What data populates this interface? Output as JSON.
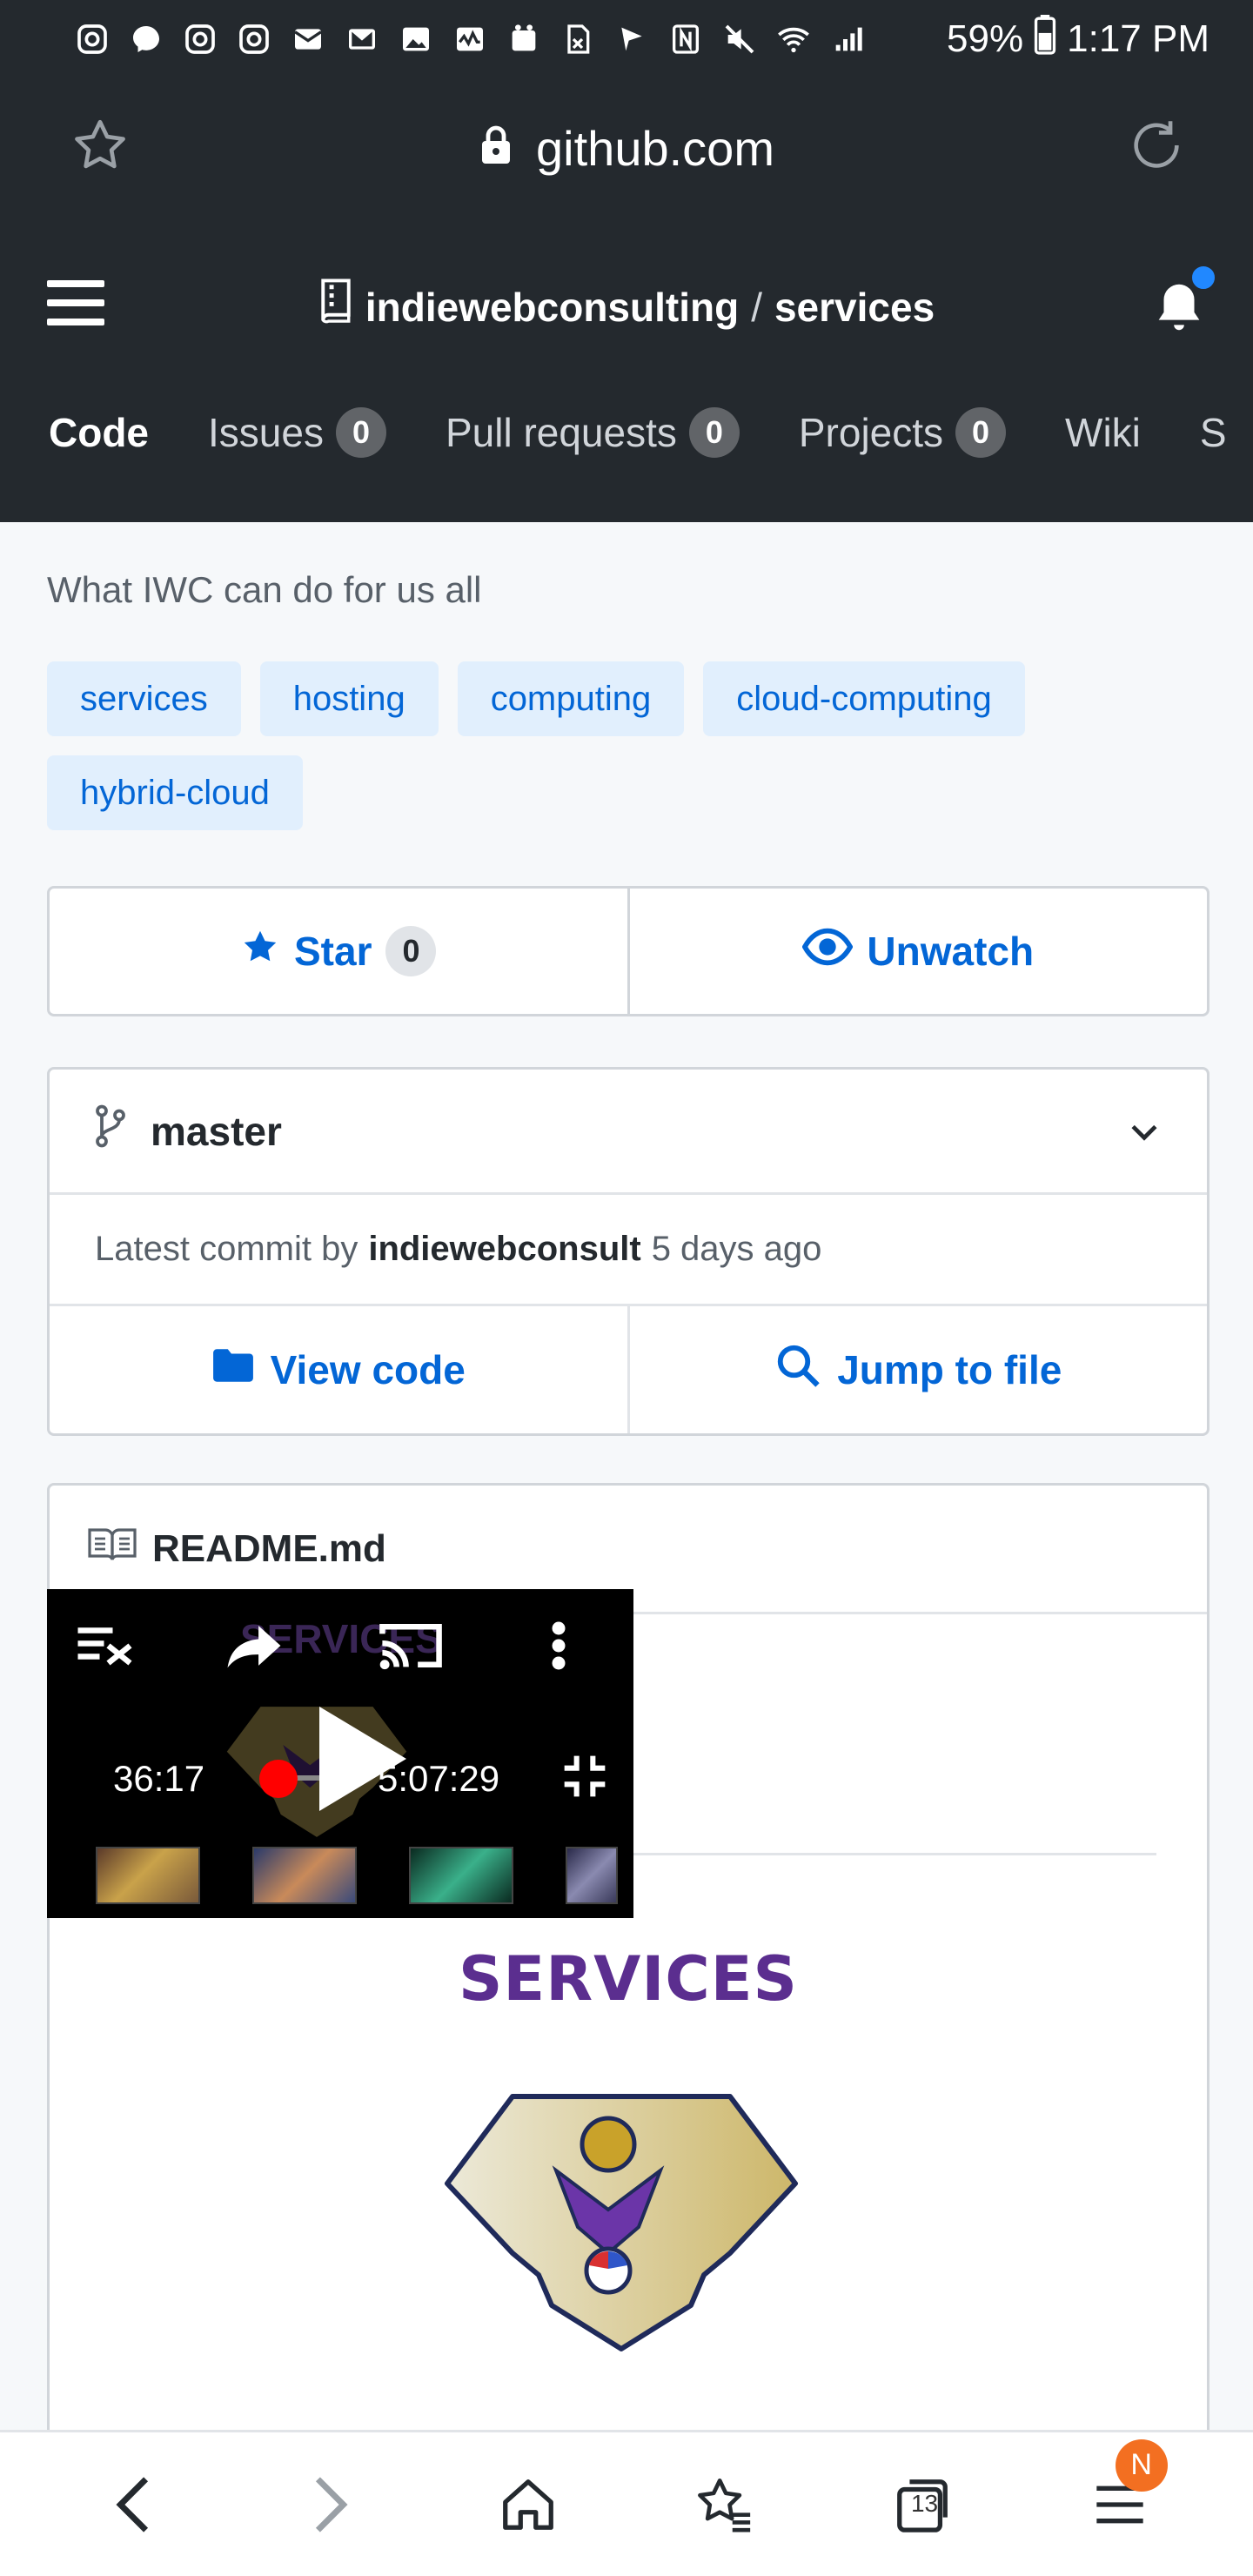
{
  "status_bar": {
    "battery": "59%",
    "time": "1:17 PM",
    "icons": [
      "instagram-icon",
      "messenger-icon",
      "instagram-icon",
      "instagram-icon",
      "mail-icon",
      "gmail-icon",
      "image-icon",
      "activity-icon",
      "app-icon",
      "sim-icon",
      "flag-icon",
      "nfc-icon",
      "mute-icon",
      "wifi-icon",
      "signal-icon",
      "battery-icon"
    ]
  },
  "browser": {
    "url": "github.com"
  },
  "repo": {
    "owner": "indiewebconsulting",
    "separator": "/",
    "name": "services"
  },
  "tabs": [
    {
      "label": "Code",
      "count": null
    },
    {
      "label": "Issues",
      "count": "0"
    },
    {
      "label": "Pull requests",
      "count": "0"
    },
    {
      "label": "Projects",
      "count": "0"
    },
    {
      "label": "Wiki",
      "count": null
    },
    {
      "label": "S",
      "count": null
    }
  ],
  "description": "What IWC can do for us all",
  "topics": [
    "services",
    "hosting",
    "computing",
    "cloud-computing",
    "hybrid-cloud"
  ],
  "star": {
    "label": "Star",
    "count": "0"
  },
  "watch": {
    "label": "Unwatch"
  },
  "branch": {
    "name": "master"
  },
  "commit": {
    "prefix": "Latest commit by",
    "author": "indiewebconsult",
    "when": "5 days ago"
  },
  "actions": {
    "view_code": "View code",
    "jump_to_file": "Jump to file"
  },
  "readme": {
    "filename": "README.md",
    "title": "SERVICES"
  },
  "video": {
    "current_time": "36:17",
    "duration": "5:07:29",
    "ghost_title": "SERVICES"
  },
  "bottom_nav": {
    "tab_count": "13",
    "menu_badge": "N"
  },
  "colors": {
    "header_bg": "#24292e",
    "link": "#0366d6",
    "topic_bg": "#e1effd",
    "services_purple": "#5b2e8f",
    "badge_orange": "#f36f21"
  }
}
